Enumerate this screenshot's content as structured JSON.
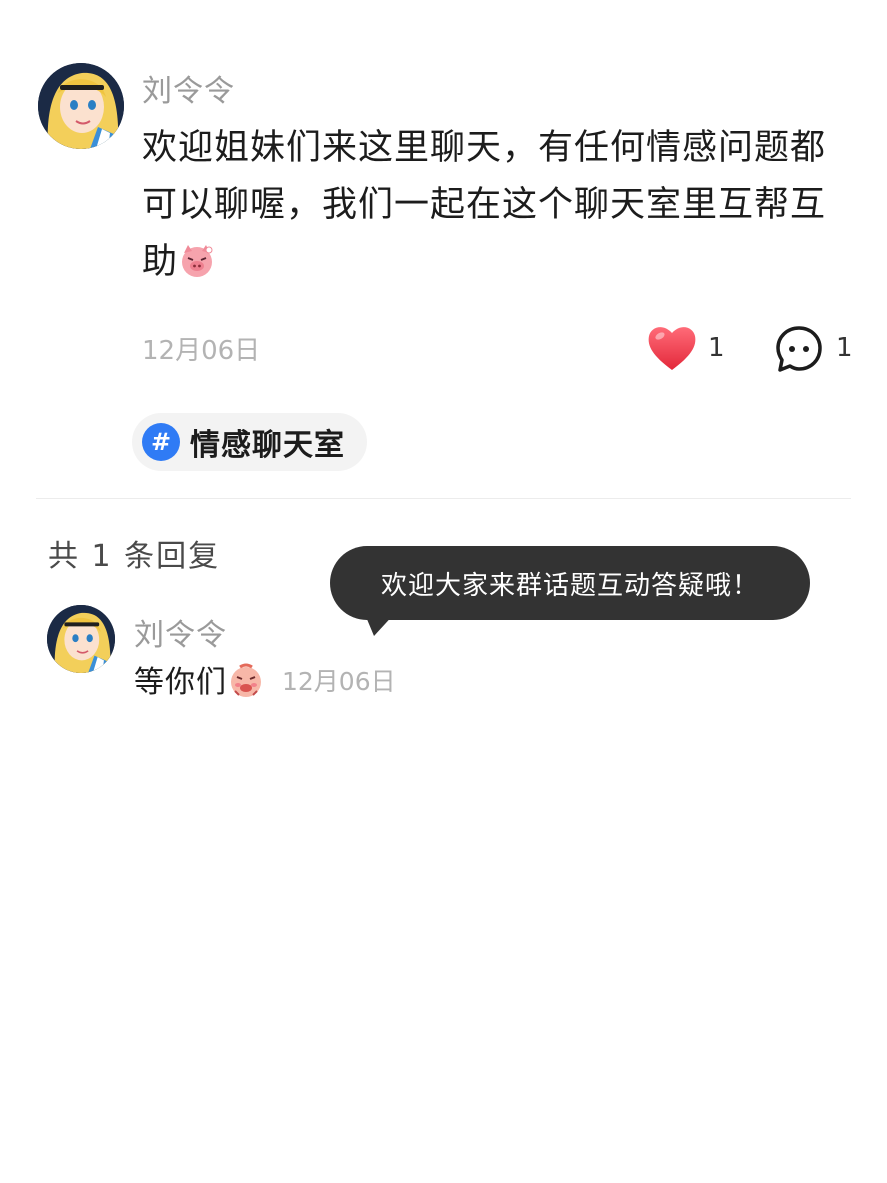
{
  "post": {
    "author": "刘令令",
    "avatar_icon": "cartoon-girl-avatar",
    "body": "欢迎姐妹们来这里聊天，有任何情感问题都可以聊喔，我们一起在这个聊天室里互帮互助",
    "body_emoji": "pig-face-emoji",
    "date": "12月06日",
    "likes": "1",
    "comments": "1",
    "topic": "情感聊天室",
    "topic_symbol": "#"
  },
  "replies": {
    "count_label": "共 1 条回复",
    "items": [
      {
        "author": "刘令令",
        "avatar_icon": "cartoon-girl-avatar",
        "text": "等你们",
        "emoji": "blushing-face-emoji",
        "date": "12月06日"
      }
    ]
  },
  "tooltip": {
    "text": "欢迎大家来群话题互动答疑哦！"
  },
  "colors": {
    "like_red": "#f0394a",
    "topic_blue": "#2f7bf5",
    "bubble_bg": "#333333"
  }
}
